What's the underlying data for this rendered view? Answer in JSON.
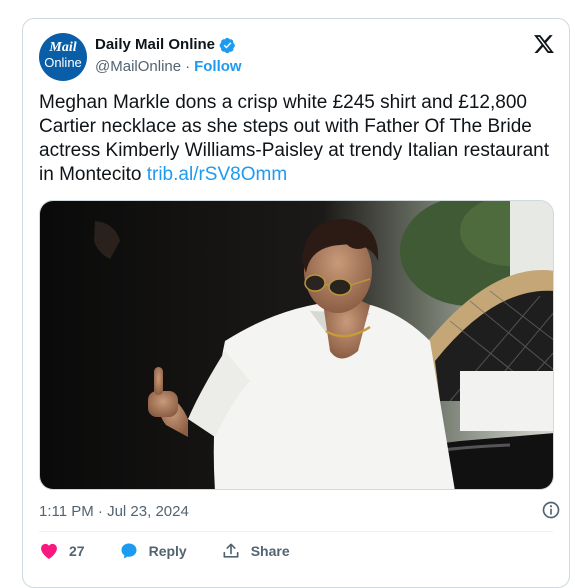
{
  "tweet": {
    "account": {
      "display_name": "Daily Mail Online",
      "handle": "@MailOnline",
      "separator": "·",
      "follow_label": "Follow",
      "avatar_line1": "Mail",
      "avatar_line2": "Online",
      "verified": true
    },
    "text": "Meghan Markle dons a crisp white £245 shirt and £12,800 Cartier necklace as she steps out with Father Of The Bride actress Kimberly Williams-Paisley at trendy Italian restaurant in Montecito",
    "link": "trib.al/rSV8Omm",
    "timestamp": "1:11 PM · Jul 23, 2024",
    "actions": {
      "like_count": "27",
      "reply_label": "Reply",
      "share_label": "Share"
    }
  },
  "colors": {
    "accent": "#1d9bf0",
    "like": "#f91880",
    "text": "#0f1419",
    "muted": "#536471",
    "avatar_bg": "#0a5ea8"
  },
  "icons": [
    "verified-badge-icon",
    "x-logo-icon",
    "info-icon",
    "heart-icon",
    "reply-icon",
    "share-icon"
  ]
}
